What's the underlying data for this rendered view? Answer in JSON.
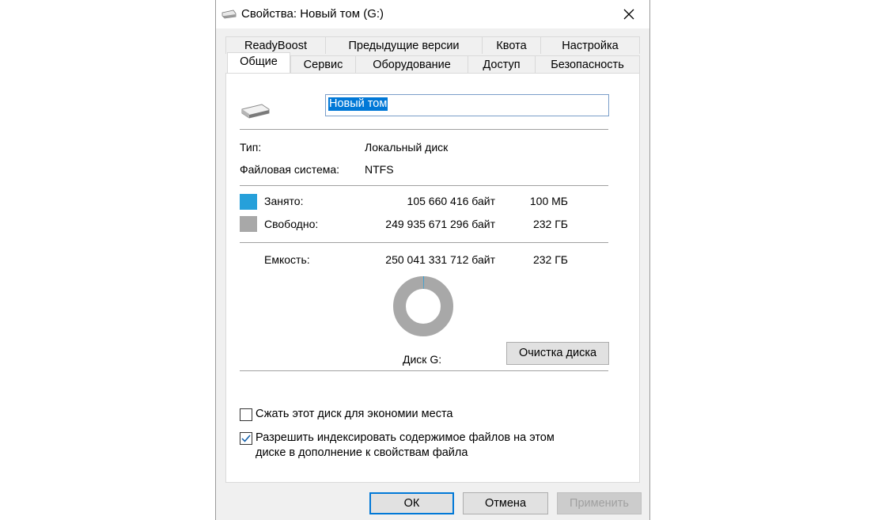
{
  "window": {
    "title": "Свойства: Новый том (G:)",
    "close_glyph": "✕"
  },
  "tabs_row1": [
    "ReadyBoost",
    "Предыдущие версии",
    "Квота",
    "Настройка"
  ],
  "tabs_row2": [
    "Общие",
    "Сервис",
    "Оборудование",
    "Доступ",
    "Безопасность"
  ],
  "active_tab": "Общие",
  "general": {
    "volume_name": "Новый том",
    "type_label": "Тип:",
    "type_value": "Локальный диск",
    "fs_label": "Файловая система:",
    "fs_value": "NTFS",
    "used_label": "Занято:",
    "used_bytes": "105 660 416 байт",
    "used_size": "100 МБ",
    "free_label": "Свободно:",
    "free_bytes": "249 935 671 296 байт",
    "free_size": "232 ГБ",
    "capacity_label": "Емкость:",
    "capacity_bytes": "250 041 331 712 байт",
    "capacity_size": "232 ГБ",
    "disk_label": "Диск G:",
    "cleanup_button": "Очистка диска",
    "used_fraction": 0.0004
  },
  "options": {
    "compress_label": "Сжать этот диск для экономии места",
    "compress_checked": false,
    "index_label_line1": "Разрешить индексировать содержимое файлов на этом",
    "index_label_line2": "диске в дополнение к свойствам файла",
    "index_checked": true
  },
  "buttons": {
    "ok": "ОК",
    "cancel": "Отмена",
    "apply": "Применить"
  },
  "colors": {
    "used": "#26a0da",
    "free": "#a8a8a8",
    "selection": "#0078d7"
  },
  "icons": {
    "drive": "drive-icon",
    "close": "close-icon",
    "check": "checkmark-icon"
  }
}
